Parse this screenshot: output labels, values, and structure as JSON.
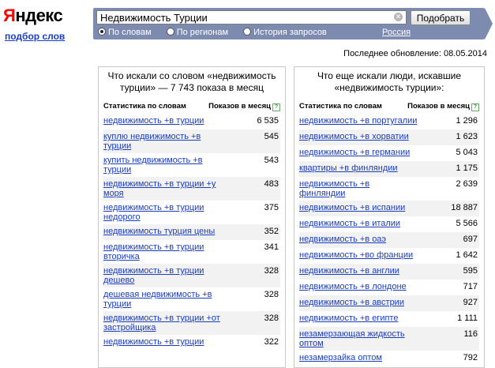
{
  "logo": {
    "first": "Я",
    "rest": "ндекс"
  },
  "sublink": "подбор слов",
  "search": {
    "value": "Недвижимость Турции",
    "button": "Подобрать"
  },
  "radios": [
    {
      "label": "По словам",
      "checked": true
    },
    {
      "label": "По регионам",
      "checked": false
    },
    {
      "label": "История запросов",
      "checked": false
    }
  ],
  "region": "Россия",
  "updated": "Последнее обновление: 08.05.2014",
  "left": {
    "title": "Что искали со словом «недвижимость турции» — 7 743 показа в месяц",
    "col1": "Статистика по словам",
    "col2": "Показов в месяц",
    "rows": [
      {
        "kw": "недвижимость +в турции",
        "n": "6 535"
      },
      {
        "kw": "куплю недвижимость +в турции",
        "n": "545"
      },
      {
        "kw": "купить недвижимость +в турции",
        "n": "543"
      },
      {
        "kw": "недвижимость +в турции +у моря",
        "n": "483"
      },
      {
        "kw": "недвижимость +в турции недорого",
        "n": "375"
      },
      {
        "kw": "недвижимость турция цены",
        "n": "352"
      },
      {
        "kw": "недвижимость +в турции вторичка",
        "n": "341"
      },
      {
        "kw": "недвижимость +в турции дешево",
        "n": "328"
      },
      {
        "kw": "дешевая недвижимость +в турции",
        "n": "328"
      },
      {
        "kw": "недвижимость +в турции +от застройщика",
        "n": "328"
      },
      {
        "kw": "недвижимость +в турции",
        "n": "322"
      }
    ]
  },
  "right": {
    "title": "Что еще искали люди, искавшие «недвижимость турции»:",
    "col1": "Статистика по словам",
    "col2": "Показов в месяц",
    "rows": [
      {
        "kw": "недвижимость +в португалии",
        "n": "1 296"
      },
      {
        "kw": "недвижимость +в хорватии",
        "n": "1 623"
      },
      {
        "kw": "недвижимость +в германии",
        "n": "5 043"
      },
      {
        "kw": "квартиры +в финляндии",
        "n": "1 175"
      },
      {
        "kw": "недвижимость +в финляндии",
        "n": "2 639"
      },
      {
        "kw": "недвижимость +в испании",
        "n": "18 887"
      },
      {
        "kw": "недвижимость +в италии",
        "n": "5 566"
      },
      {
        "kw": "недвижимость +в оаэ",
        "n": "697"
      },
      {
        "kw": "недвижимость +во франции",
        "n": "1 642"
      },
      {
        "kw": "недвижимость +в англии",
        "n": "595"
      },
      {
        "kw": "недвижимость +в лондоне",
        "n": "717"
      },
      {
        "kw": "недвижимость +в австрии",
        "n": "927"
      },
      {
        "kw": "недвижимость +в египте",
        "n": "1 111"
      },
      {
        "kw": "незамерзающая жидкость оптом",
        "n": "116"
      },
      {
        "kw": "незамерзайка оптом",
        "n": "792"
      }
    ]
  }
}
